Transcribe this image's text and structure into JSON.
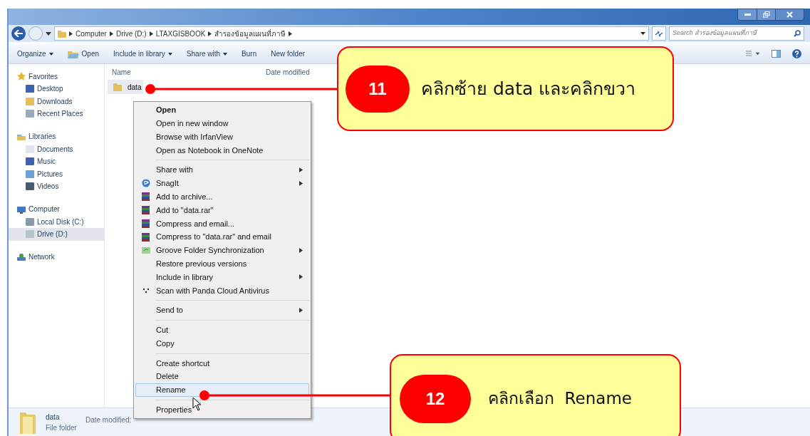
{
  "address_bar": {
    "breadcrumbs": [
      "Computer",
      "Drive (D:)",
      "LTAXGISBOOK",
      "สำรองข้อมูลแผนที่ภาษี"
    ],
    "search_placeholder": "Search สำรองข้อมูลแผนที่ภาษี"
  },
  "toolbar": [
    {
      "label": "Organize",
      "dropdown": true
    },
    {
      "label": "Open",
      "dropdown": false,
      "icon": true
    },
    {
      "label": "Include in library",
      "dropdown": true
    },
    {
      "label": "Share with",
      "dropdown": true
    },
    {
      "label": "Burn",
      "dropdown": false
    },
    {
      "label": "New folder",
      "dropdown": false
    }
  ],
  "sidebar": [
    {
      "label": "Favorites",
      "children": [
        {
          "label": "Desktop",
          "selected": false
        },
        {
          "label": "Downloads",
          "selected": false
        },
        {
          "label": "Recent Places",
          "selected": false
        }
      ]
    },
    {
      "label": "Libraries",
      "children": [
        {
          "label": "Documents",
          "selected": false
        },
        {
          "label": "Music",
          "selected": false
        },
        {
          "label": "Pictures",
          "selected": false
        },
        {
          "label": "Videos",
          "selected": false
        }
      ]
    },
    {
      "label": "Computer",
      "children": [
        {
          "label": "Local Disk (C:)",
          "selected": false
        },
        {
          "label": "Drive (D:)",
          "selected": true
        }
      ]
    },
    {
      "label": "Network"
    }
  ],
  "file_list": {
    "columns": [
      "Name",
      "Date modified"
    ],
    "rows": [
      {
        "name": "data",
        "selected": true
      }
    ]
  },
  "context_menu": [
    {
      "kind": "item",
      "label": "Open",
      "default": true
    },
    {
      "kind": "item",
      "label": "Open in new window"
    },
    {
      "kind": "item",
      "label": "Browse with IrfanView"
    },
    {
      "kind": "item",
      "label": "Open as Notebook in OneNote"
    },
    {
      "kind": "separator"
    },
    {
      "kind": "item",
      "label": "Share with",
      "submenu": true
    },
    {
      "kind": "snagit",
      "label": "SnagIt",
      "submenu": true
    },
    {
      "kind": "archive",
      "label": "Add to archive..."
    },
    {
      "kind": "archive",
      "label": "Add to \"data.rar\""
    },
    {
      "kind": "archive",
      "label": "Compress and email..."
    },
    {
      "kind": "archive",
      "label": "Compress to \"data.rar\" and email"
    },
    {
      "kind": "sync",
      "label": "Groove Folder Synchronization",
      "submenu": true
    },
    {
      "kind": "item",
      "label": "Restore previous versions"
    },
    {
      "kind": "item",
      "label": "Include in library",
      "submenu": true
    },
    {
      "kind": "scan",
      "label": "Scan with Panda Cloud Antivirus"
    },
    {
      "kind": "separator"
    },
    {
      "kind": "item",
      "label": "Send to",
      "submenu": true
    },
    {
      "kind": "separator"
    },
    {
      "kind": "item",
      "label": "Cut"
    },
    {
      "kind": "item",
      "label": "Copy"
    },
    {
      "kind": "separator"
    },
    {
      "kind": "item",
      "label": "Create shortcut"
    },
    {
      "kind": "item",
      "label": "Delete"
    },
    {
      "kind": "item",
      "label": "Rename",
      "selected": true
    },
    {
      "kind": "separator"
    },
    {
      "kind": "item",
      "label": "Properties"
    }
  ],
  "status_bar": {
    "name": "data",
    "date_label": "Date modified:",
    "type": "File folder"
  },
  "callouts": [
    {
      "number": "11",
      "text": "คลิกซ้าย data และคลิกขวา"
    },
    {
      "number": "12",
      "text": "คลิกเลือก  Rename"
    }
  ]
}
